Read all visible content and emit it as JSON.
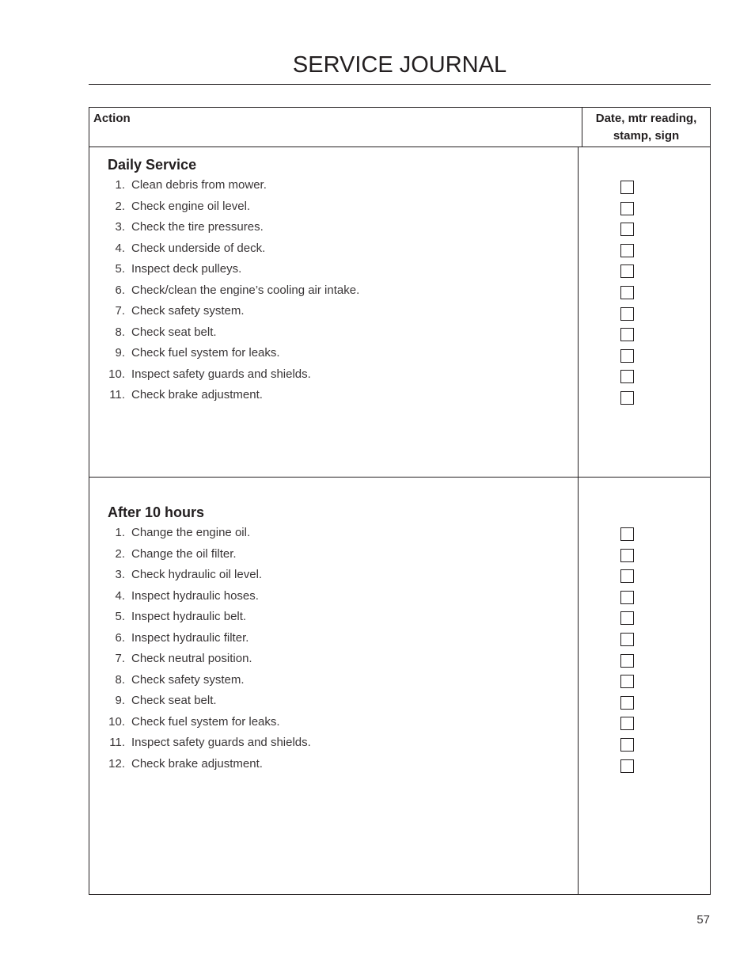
{
  "page": {
    "title": "SERVICE JOURNAL",
    "page_number": "57"
  },
  "table": {
    "headers": {
      "action": "Action",
      "sign_line1": "Date, mtr reading,",
      "sign_line2": "stamp, sign"
    },
    "sections": [
      {
        "title": "Daily Service",
        "items": [
          {
            "num": "1.",
            "text": "Clean debris from mower.",
            "checked": false
          },
          {
            "num": "2.",
            "text": "Check engine oil level.",
            "checked": false
          },
          {
            "num": "3.",
            "text": "Check the tire pressures.",
            "checked": false
          },
          {
            "num": "4.",
            "text": "Check underside of deck.",
            "checked": false
          },
          {
            "num": "5.",
            "text": "Inspect deck pulleys.",
            "checked": false
          },
          {
            "num": "6.",
            "text": "Check/clean the engine’s cooling air intake.",
            "checked": false
          },
          {
            "num": "7.",
            "text": "Check safety system.",
            "checked": false
          },
          {
            "num": "8.",
            "text": "Check seat belt.",
            "checked": false
          },
          {
            "num": "9.",
            "text": "Check fuel system for leaks.",
            "checked": false
          },
          {
            "num": "10.",
            "text": "Inspect safety guards and shields.",
            "checked": false
          },
          {
            "num": "11.",
            "text": "Check brake adjustment.",
            "checked": false
          }
        ]
      },
      {
        "title": "After 10 hours",
        "items": [
          {
            "num": "1.",
            "text": "Change the engine oil.",
            "checked": false
          },
          {
            "num": "2.",
            "text": "Change the oil filter.",
            "checked": false
          },
          {
            "num": "3.",
            "text": "Check hydraulic oil level.",
            "checked": false
          },
          {
            "num": "4.",
            "text": "Inspect hydraulic hoses.",
            "checked": false
          },
          {
            "num": "5.",
            "text": "Inspect hydraulic belt.",
            "checked": false
          },
          {
            "num": "6.",
            "text": "Inspect hydraulic filter.",
            "checked": false
          },
          {
            "num": "7.",
            "text": "Check neutral position.",
            "checked": false
          },
          {
            "num": "8.",
            "text": "Check safety system.",
            "checked": false
          },
          {
            "num": "9.",
            "text": "Check seat belt.",
            "checked": false
          },
          {
            "num": "10.",
            "text": "Check fuel system for leaks.",
            "checked": false
          },
          {
            "num": "11.",
            "text": "Inspect safety guards and shields.",
            "checked": false
          },
          {
            "num": "12.",
            "text": "Check brake adjustment.",
            "checked": false
          }
        ]
      }
    ]
  }
}
